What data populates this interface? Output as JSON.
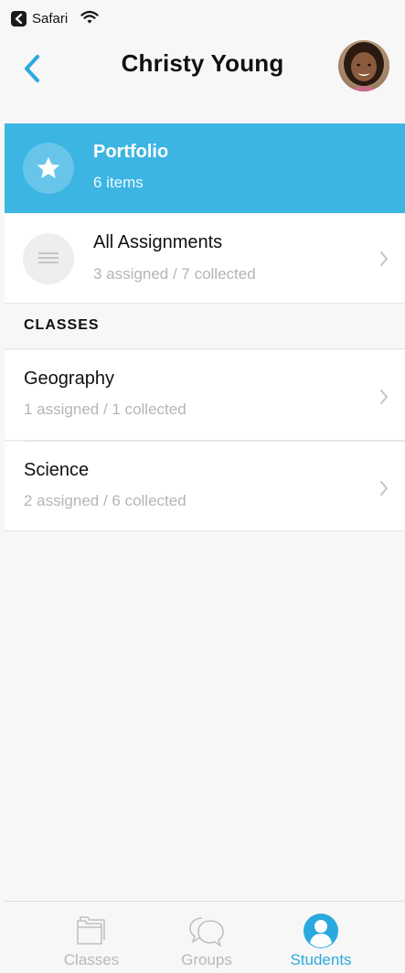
{
  "status_bar": {
    "back_app_label": "Safari"
  },
  "header": {
    "title": "Christy Young"
  },
  "portfolio": {
    "title": "Portfolio",
    "subtitle": "6 items"
  },
  "all_assignments": {
    "title": "All Assignments",
    "subtitle": "3 assigned / 7 collected"
  },
  "classes_section": {
    "header": "CLASSES",
    "items": [
      {
        "name": "Geography",
        "subtitle": "1 assigned / 1 collected"
      },
      {
        "name": "Science",
        "subtitle": "2 assigned / 6 collected"
      }
    ]
  },
  "tabbar": {
    "tabs": [
      {
        "label": "Classes",
        "icon": "folders-icon",
        "active": false
      },
      {
        "label": "Groups",
        "icon": "chat-bubbles-icon",
        "active": false
      },
      {
        "label": "Students",
        "icon": "person-icon",
        "active": true
      }
    ]
  },
  "colors": {
    "accent": "#3db5e3",
    "active_tab": "#2aa9de",
    "inactive_tab": "#b8b8b8",
    "subtitle_gray": "#b5b5b5"
  }
}
